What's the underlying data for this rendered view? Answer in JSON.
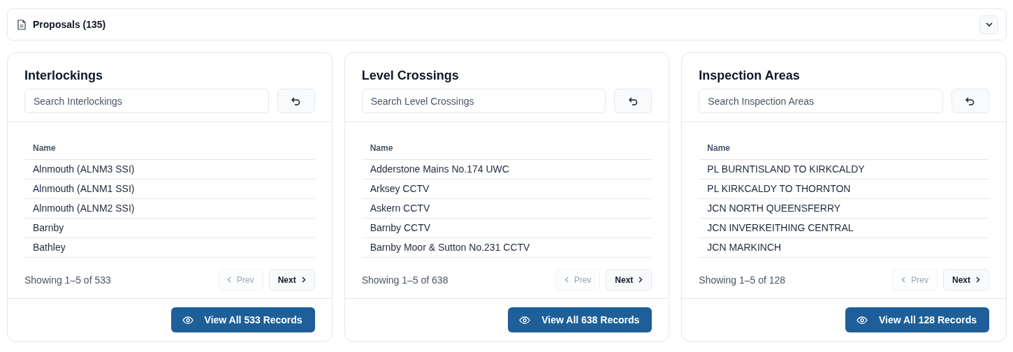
{
  "header": {
    "title": "Proposals (135)",
    "expanded": false
  },
  "panels": [
    {
      "title": "Interlockings",
      "search": {
        "placeholder": "Search Interlockings"
      },
      "column": "Name",
      "rows": [
        "Alnmouth (ALNM3 SSI)",
        "Alnmouth (ALNM1 SSI)",
        "Alnmouth (ALNM2 SSI)",
        "Barnby",
        "Bathley"
      ],
      "showing": "Showing 1–5 of 533",
      "prev": {
        "label": "Prev",
        "disabled": true
      },
      "next": {
        "label": "Next",
        "disabled": false
      },
      "view_all": "View All 533 Records"
    },
    {
      "title": "Level Crossings",
      "search": {
        "placeholder": "Search Level Crossings"
      },
      "column": "Name",
      "rows": [
        "Adderstone Mains No.174 UWC",
        "Arksey CCTV",
        "Askern CCTV",
        "Barnby CCTV",
        "Barnby Moor & Sutton No.231 CCTV"
      ],
      "showing": "Showing 1–5 of 638",
      "prev": {
        "label": "Prev",
        "disabled": true
      },
      "next": {
        "label": "Next",
        "disabled": false
      },
      "view_all": "View All 638 Records"
    },
    {
      "title": "Inspection Areas",
      "search": {
        "placeholder": "Search Inspection Areas"
      },
      "column": "Name",
      "rows": [
        "PL BURNTISLAND TO KIRKCALDY",
        "PL KIRKCALDY TO THORNTON",
        "JCN NORTH QUEENSFERRY",
        "JCN INVERKEITHING CENTRAL",
        "JCN MARKINCH"
      ],
      "showing": "Showing 1–5 of 128",
      "prev": {
        "label": "Prev",
        "disabled": true
      },
      "next": {
        "label": "Next",
        "disabled": false
      },
      "view_all": "View All 128 Records"
    }
  ]
}
